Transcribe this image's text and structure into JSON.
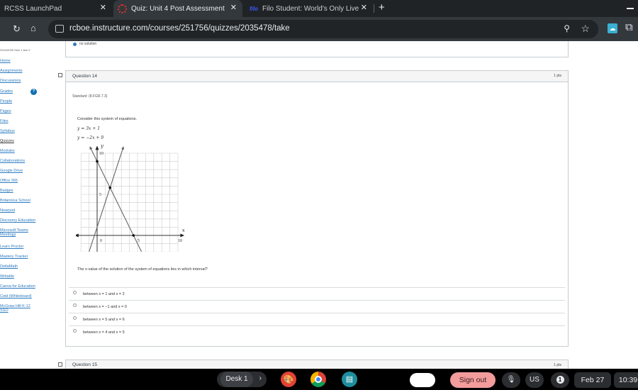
{
  "browser": {
    "tabs": [
      {
        "label": "RCSS LaunchPad",
        "active": false
      },
      {
        "label": "Quiz: Unit 4 Post Assessment",
        "active": true
      },
      {
        "label": "Filo Student: World's Only Live",
        "active": false
      }
    ],
    "close_glyph": "✕",
    "new_tab_glyph": "+",
    "url": "rcboe.instructure.com/courses/251756/quizzes/2035478/take"
  },
  "sidebar": {
    "term": "2024/2025 Sem 1 Ave 2",
    "items": [
      {
        "label": "Home"
      },
      {
        "label": "Assignments"
      },
      {
        "label": "Discussions"
      },
      {
        "label": "Grades",
        "badge": "?"
      },
      {
        "label": "People"
      },
      {
        "label": "Pages"
      },
      {
        "label": "Files"
      },
      {
        "label": "Syllabus"
      },
      {
        "label": "Quizzes",
        "current": true
      },
      {
        "label": "Modules"
      },
      {
        "label": "Collaborations"
      },
      {
        "label": "Google Drive"
      },
      {
        "label": "Office 365"
      },
      {
        "label": "Badges"
      },
      {
        "label": "Britannica School"
      },
      {
        "label": "Nearpod"
      },
      {
        "label": "Discovery Education"
      },
      {
        "label": "Microsoft Teams Meetings"
      },
      {
        "label": "Learn Proctor"
      },
      {
        "label": "Mastery Tracker"
      },
      {
        "label": "DeltaMath"
      },
      {
        "label": "Writable"
      },
      {
        "label": "Canva for Education"
      },
      {
        "label": "Ceid (Whiteboard)"
      },
      {
        "label": "McGraw Hill K-12 SSO"
      }
    ]
  },
  "previous_question": {
    "selected_answer": "no solution"
  },
  "question": {
    "title": "Question 14",
    "points": "1 pts",
    "standard": "Standard: (8.FGR.7.3)",
    "prompt": "Consider this system of equations.",
    "equations": [
      "y = 3x + 1",
      "y = −2x + 9"
    ],
    "graph": {
      "x_label": "x",
      "y_label": "y",
      "x_ticks": [
        "0",
        "5",
        "10"
      ],
      "y_ticks": [
        "5",
        "10"
      ],
      "xlim": [
        -2,
        10
      ],
      "ylim": [
        -3,
        10
      ],
      "lines": [
        {
          "equation": "y = 3x + 1",
          "slope": 3,
          "intercept": 1
        },
        {
          "equation": "y = -2x + 9",
          "slope": -2,
          "intercept": 9
        }
      ],
      "points": [
        {
          "x": 0,
          "y": 9
        },
        {
          "x": 1.6,
          "y": 5.8
        },
        {
          "x": 4.5,
          "y": 0
        }
      ]
    },
    "question_text": "The x-value of the solution of the system of equations lies in which interval?",
    "answers": [
      {
        "label": "between x = 1 and x = 2"
      },
      {
        "label": "between x = −1 and x = 0"
      },
      {
        "label": "between x = 5 and x = 6"
      },
      {
        "label": "between x = 4 and x = 5"
      }
    ]
  },
  "next_question": {
    "title": "Question 15",
    "points": "1 pts"
  },
  "shelf": {
    "desk_label": "Desk 1",
    "sign_out": "Sign out",
    "input_method": "US",
    "notification_count": "1",
    "date": "Feb 27",
    "time": "10:39"
  }
}
